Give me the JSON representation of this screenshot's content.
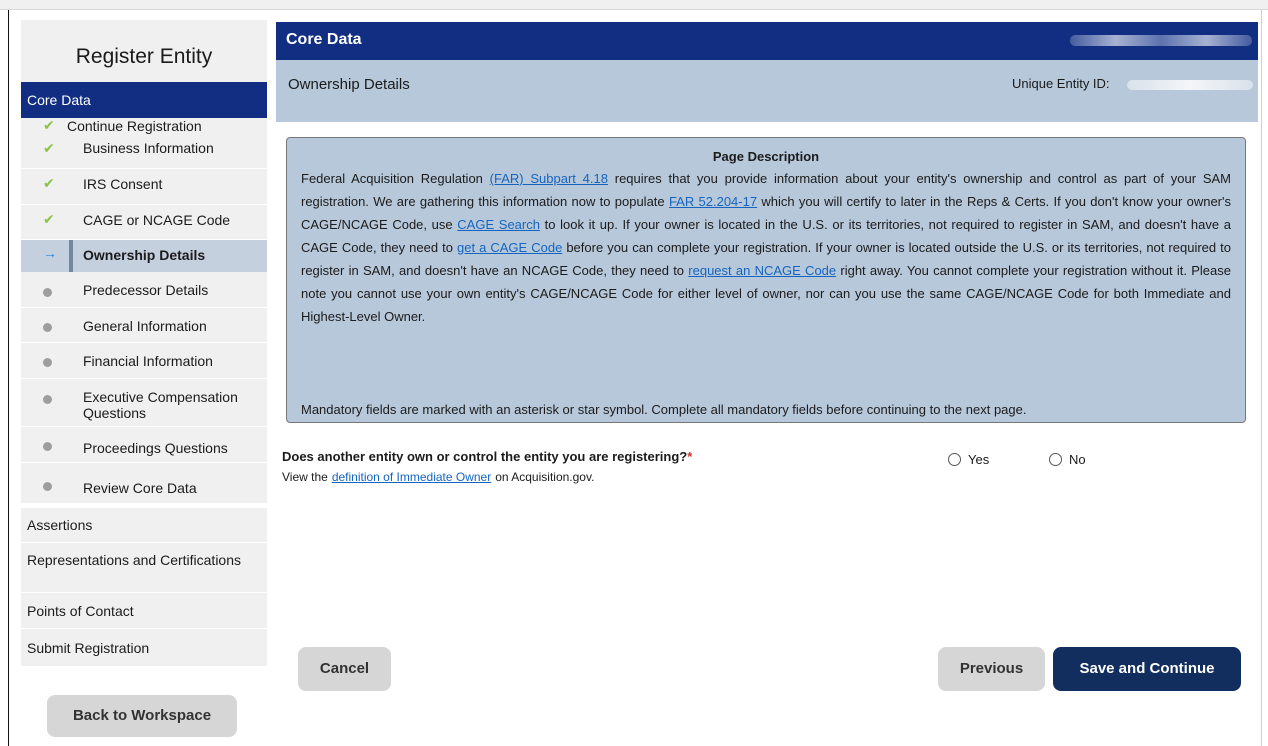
{
  "sidebar": {
    "title": "Register Entity",
    "section_active": "Core Data",
    "sub_items": [
      {
        "label": "Continue Registration",
        "state": "done"
      },
      {
        "label": "Business Information",
        "state": "done"
      },
      {
        "label": "IRS Consent",
        "state": "done"
      },
      {
        "label": "CAGE or NCAGE Code",
        "state": "done"
      },
      {
        "label": "Ownership Details",
        "state": "current"
      },
      {
        "label": "Predecessor Details",
        "state": "pending"
      },
      {
        "label": "General Information",
        "state": "pending"
      },
      {
        "label": "Financial Information",
        "state": "pending"
      },
      {
        "label": "Executive Compensation Questions",
        "state": "pending"
      },
      {
        "label": "Proceedings Questions",
        "state": "pending"
      },
      {
        "label": "Review Core Data",
        "state": "pending"
      }
    ],
    "sections": [
      "Assertions",
      "Representations and Certifications",
      "Points of Contact",
      "Submit Registration"
    ],
    "back_button": "Back to Workspace"
  },
  "header": {
    "title": "Core Data"
  },
  "subheader": {
    "title": "Ownership Details",
    "uei_label": "Unique Entity ID:"
  },
  "description": {
    "heading": "Page Description",
    "t1": "Federal Acquisition Regulation ",
    "link_far_subpart": "(FAR) Subpart 4.18",
    "t2": " requires that you provide information about your entity's ownership and control as part of your SAM registration. We are gathering this information now to populate ",
    "link_far_clause": "FAR 52.204-17",
    "t3": " which you will certify to later in the Reps & Certs. If you don't know your owner's CAGE/NCAGE Code, use ",
    "link_cage_search": "CAGE Search",
    "t4": " to look it up. If your owner is located in the U.S. or its territories, not required to register in SAM, and doesn't have a CAGE Code, they need to ",
    "link_get_cage": "get a CAGE Code",
    "t5": " before you can complete your registration. If your owner is located outside the U.S. or its territories, not required to register in SAM, and doesn't have an NCAGE Code, they need to ",
    "link_request_ncage": "request an NCAGE Code",
    "t6": " right away. You cannot complete your registration without it. Please note you cannot use your own entity's CAGE/NCAGE Code for either level of owner, nor can you use the same CAGE/NCAGE Code for both Immediate and Highest-Level Owner.",
    "mandatory": "Mandatory fields are marked with an asterisk or star symbol. Complete all mandatory fields before continuing to the next page."
  },
  "question": {
    "text": "Does another entity own or control the entity you are registering?",
    "required_mark": "*",
    "hint_pre": "View the",
    "hint_link": "definition of Immediate Owner",
    "hint_post": "on Acquisition.gov.",
    "options": [
      "Yes",
      "No"
    ]
  },
  "buttons": {
    "cancel": "Cancel",
    "previous": "Previous",
    "save_continue": "Save and Continue"
  }
}
